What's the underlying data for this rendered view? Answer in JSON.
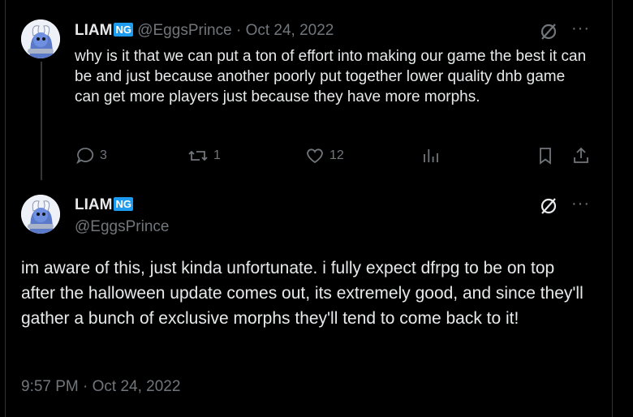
{
  "colors": {
    "background": "#000000",
    "text": "#e7e9ea",
    "muted": "#71767b",
    "badge": "#1d9bf0"
  },
  "parent": {
    "name": "LIAM",
    "badge": "NG",
    "handle": "@EggsPrince",
    "separator": "·",
    "date": "Oct 24, 2022",
    "text": "why is it that we can put a ton of effort into making our game the best it can be and just because another poorly put together lower quality dnb game can get more players just because they have more morphs.",
    "more": "···",
    "actions": {
      "replies": "3",
      "reposts": "1",
      "likes": "12"
    }
  },
  "reply": {
    "name": "LIAM",
    "badge": "NG",
    "handle": "@EggsPrince",
    "more": "···",
    "text": "im aware of this, just kinda unfortunate. i fully expect dfrpg to be on top after the halloween update comes out, its extremely good, and since they'll gather a bunch of exclusive morphs they'll tend to come back to it!",
    "timestamp": "9:57 PM · Oct 24, 2022"
  }
}
